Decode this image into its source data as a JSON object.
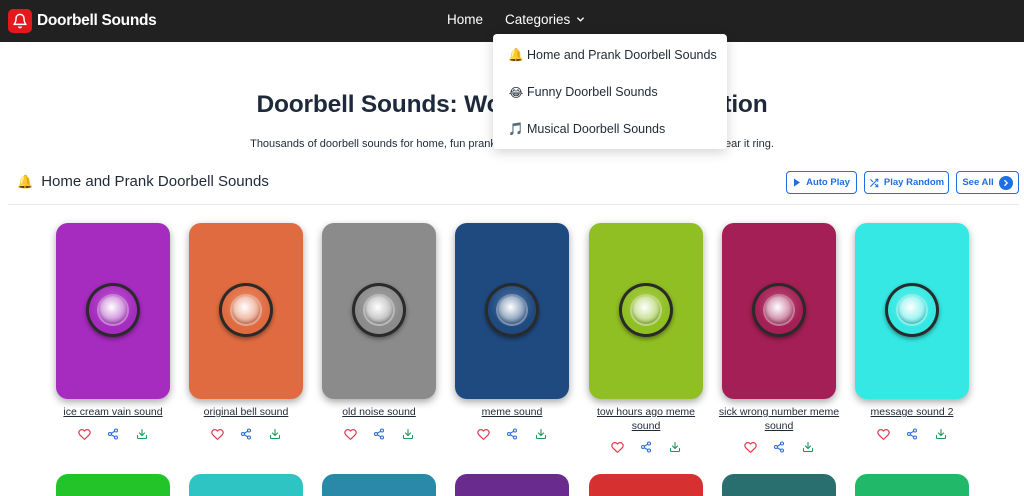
{
  "brand": {
    "name": "Doorbell Sounds"
  },
  "nav": {
    "home": "Home",
    "categories": "Categories"
  },
  "dropdown": {
    "items": [
      {
        "emoji": "🔔",
        "label": "Home and Prank Doorbell Sounds"
      },
      {
        "emoji": "😂",
        "label": "Funny Doorbell Sounds"
      },
      {
        "emoji": "🎵",
        "label": "Musical Doorbell Sounds"
      }
    ]
  },
  "hero": {
    "title": "Doorbell Sounds: Wo",
    "title_end": "tion",
    "subtitle": "Thousands of doorbell sounds for home, fun prank,",
    "subtitle_end": "ear it ring."
  },
  "section": {
    "emoji": "🔔",
    "title": "Home and Prank Doorbell Sounds",
    "auto_play": "Auto Play",
    "play_random": "Play Random",
    "see_all": "See All"
  },
  "sounds": [
    {
      "name": "ice cream vain sound",
      "color": "#a62bbf"
    },
    {
      "name": "original bell sound",
      "color": "#e06b40"
    },
    {
      "name": "old noise sound",
      "color": "#8b8b8b"
    },
    {
      "name": "meme sound",
      "color": "#1f4a80"
    },
    {
      "name": "tow hours ago meme sound",
      "color": "#8fbf22"
    },
    {
      "name": "sick wrong number meme sound",
      "color": "#a31f55"
    },
    {
      "name": "message sound 2",
      "color": "#35e8e3"
    }
  ],
  "next_row_colors": [
    "#22c42a",
    "#2ec4c4",
    "#2a88a8",
    "#6a2b8f",
    "#d63030",
    "#2a6f6f",
    "#22b86a"
  ],
  "colors": {
    "navbar": "#212121",
    "accent": "#1d6fe3",
    "heart": "#e0344a",
    "share": "#2f6fd8",
    "download": "#1a9a5a"
  }
}
